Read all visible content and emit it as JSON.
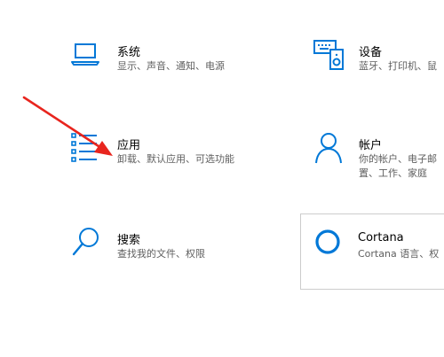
{
  "accent_color": "#0078d7",
  "annotation_color": "#e8251e",
  "tiles": [
    {
      "icon": "laptop-icon",
      "title": "系统",
      "description": "显示、声音、通知、电源"
    },
    {
      "icon": "devices-icon",
      "title": "设备",
      "description": "蓝牙、打印机、鼠"
    },
    {
      "icon": "apps-icon",
      "title": "应用",
      "description": "卸载、默认应用、可选功能"
    },
    {
      "icon": "person-icon",
      "title": "帐户",
      "description_line1": "你的帐户、电子邮",
      "description_line2": "置、工作、家庭"
    },
    {
      "icon": "search-icon",
      "title": "搜索",
      "description": "查找我的文件、权限"
    },
    {
      "icon": "cortana-icon",
      "title": "Cortana",
      "description": "Cortana 语言、权"
    }
  ],
  "annotation": {
    "icon": "red-arrow-icon"
  }
}
